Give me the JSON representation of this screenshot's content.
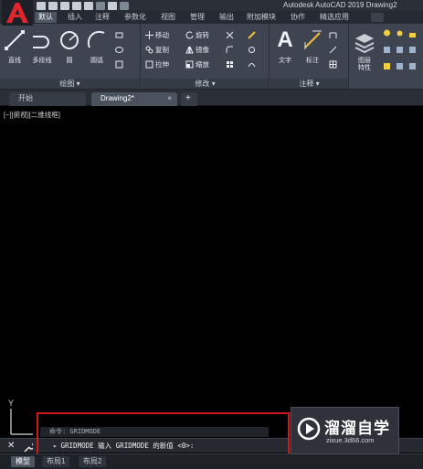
{
  "app": {
    "title": "Autodesk AutoCAD 2019    Drawing2"
  },
  "ribbon_tabs": [
    {
      "label": "默认",
      "active": true
    },
    {
      "label": "插入"
    },
    {
      "label": "注释"
    },
    {
      "label": "参数化"
    },
    {
      "label": "视图"
    },
    {
      "label": "管理"
    },
    {
      "label": "输出"
    },
    {
      "label": "附加模块"
    },
    {
      "label": "协作"
    },
    {
      "label": "精选应用"
    }
  ],
  "ribbon": {
    "draw": {
      "title": "绘图 ▾",
      "line": "直线",
      "polyline": "多段线",
      "circle": "圆",
      "arc": "圆弧"
    },
    "modify": {
      "title": "修改 ▾",
      "move": "移动",
      "rotate": "旋转",
      "copy": "复制",
      "mirror": "镜像",
      "stretch": "拉伸",
      "scale": "缩放"
    },
    "annotation": {
      "title": "注释 ▾",
      "text": "文字",
      "dimension": "标注"
    },
    "layers": {
      "properties": "图层\n特性"
    }
  },
  "document_tabs": {
    "start": "开始",
    "drawing": "Drawing2*",
    "drawing_close": "×",
    "add": "+"
  },
  "viewport": {
    "label": "[−][俯视][二维线框]"
  },
  "ucs": {
    "y_label": "Y"
  },
  "command": {
    "history": "命令: GRIDMODE",
    "prompt": "GRIDMODE 输入 GRIDMODE 的新值 <0>:",
    "close": "✕"
  },
  "layout_tabs": [
    {
      "label": "模型",
      "active": true
    },
    {
      "label": "布局1"
    },
    {
      "label": "布局2"
    }
  ],
  "watermark": {
    "title": "溜溜自学",
    "url": "zixue.3d66.com"
  },
  "colors": {
    "highlight": "#d0171b",
    "logo_red": "#e0262c",
    "canvas": "#000000"
  }
}
